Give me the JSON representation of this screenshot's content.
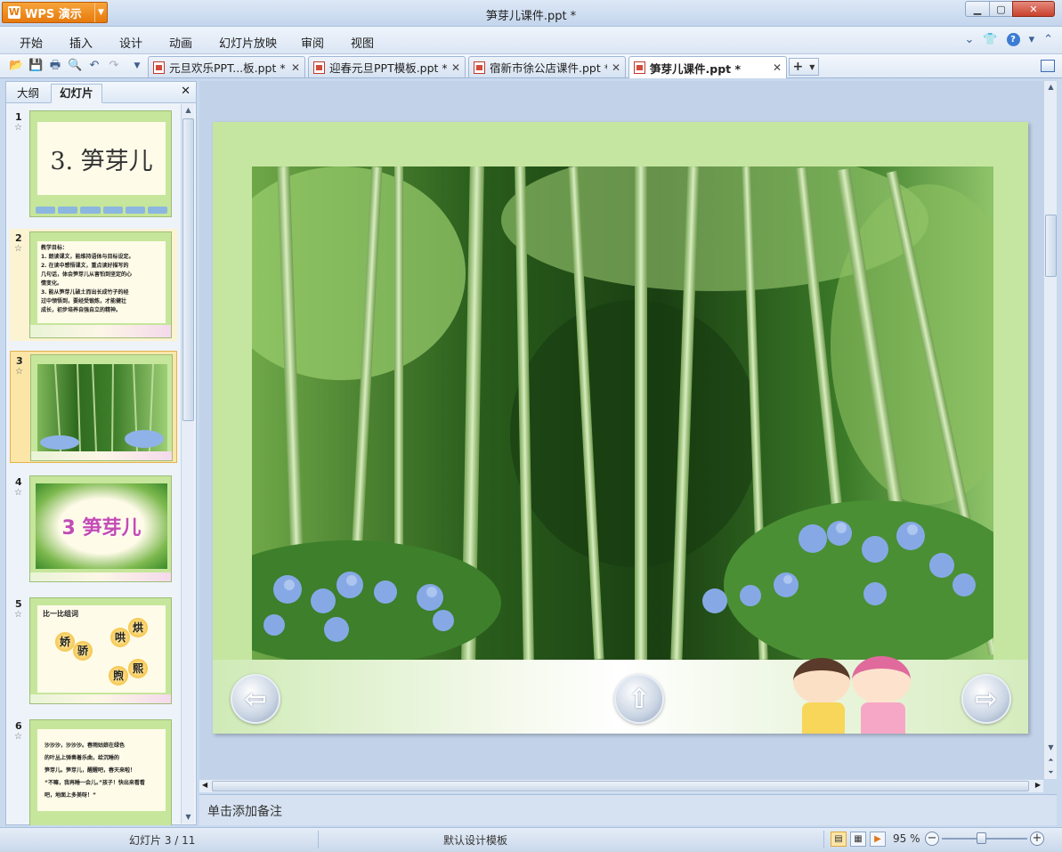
{
  "app": {
    "name": "WPS 演示",
    "document_title": "笋芽儿课件.ppt *"
  },
  "menu": [
    "开始",
    "插入",
    "设计",
    "动画",
    "幻灯片放映",
    "审阅",
    "视图"
  ],
  "tabs": [
    {
      "label": "元旦欢乐PPT...板.ppt *",
      "active": false
    },
    {
      "label": "迎春元旦PPT模板.ppt *",
      "active": false
    },
    {
      "label": "宿新市徐公店课件.ppt *",
      "active": false
    },
    {
      "label": "笋芽儿课件.ppt *",
      "active": true
    }
  ],
  "panel": {
    "tab_outline": "大纲",
    "tab_slides": "幻灯片"
  },
  "slides": [
    {
      "num": "1",
      "title": "3. 笋芽儿"
    },
    {
      "num": "2",
      "heading": "教学目标：",
      "lines": [
        "1. 朗读课文，能维持语体与目标设定。",
        "2. 在读中感悟课文，重点读好描写的",
        "   几句话，体会笋芽儿从害怕到坚定的心",
        "   情变化。",
        "3. 能从笋芽儿破土而出长成竹子的经",
        "   过中领悟到，要经受锻炼，才能健壮",
        "   成长，初步培养自强自立的精神。"
      ]
    },
    {
      "num": "3"
    },
    {
      "num": "4",
      "title": "3 笋芽儿"
    },
    {
      "num": "5",
      "heading": "比一比组词",
      "chars": [
        "娇",
        "骄",
        "哄",
        "烘",
        "煦",
        "熙"
      ]
    },
    {
      "num": "6",
      "lines": [
        "沙沙沙，沙沙沙。春雨姑娘在绿色",
        "的叶丛上弹奏着乐曲，给沉睡的",
        "笋芽儿。笋芽儿，醒醒吧，春天来啦！",
        "“不嘛，我再睡一会儿。”孩子！快出来看看",
        "吧，地面上多美呀！”"
      ]
    }
  ],
  "notes_placeholder": "单击添加备注",
  "status": {
    "slide_indicator": "幻灯片 3 / 11",
    "template": "默认设计模板",
    "zoom": "95 %"
  }
}
